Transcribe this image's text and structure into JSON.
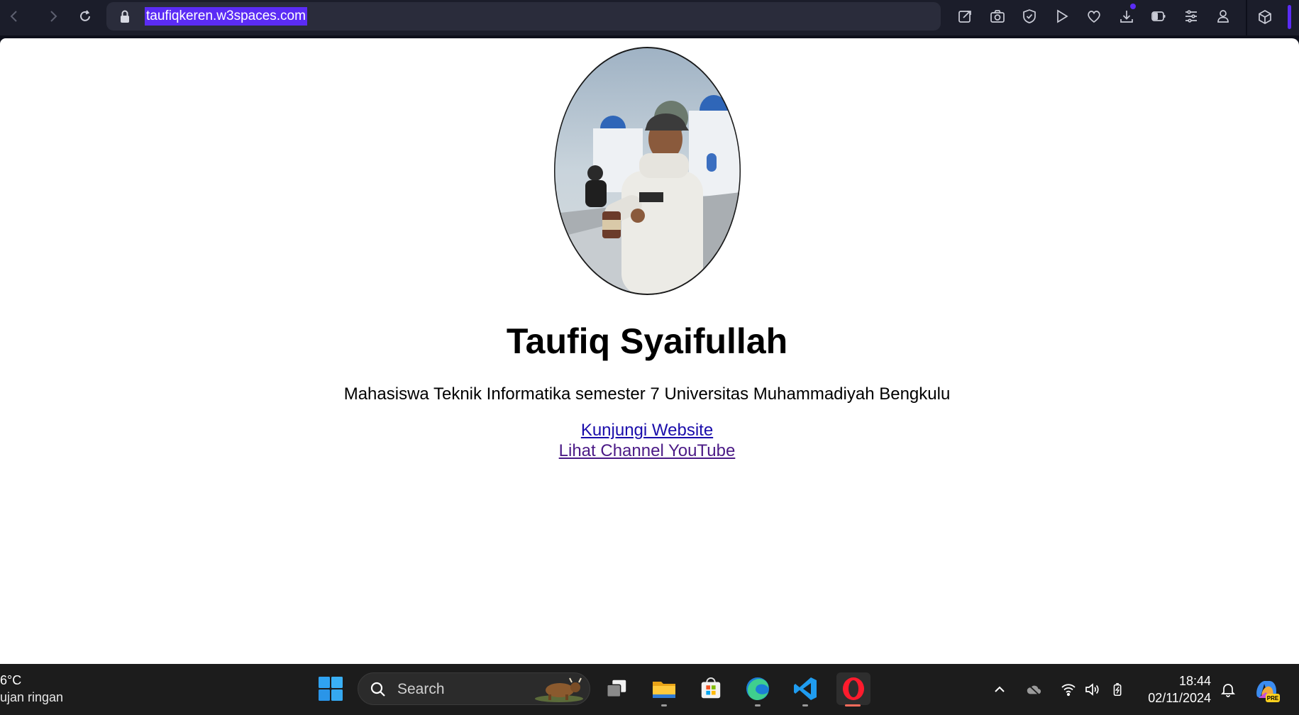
{
  "browser": {
    "url": "taufiqkeren.w3spaces.com",
    "nav_icons": [
      "back-icon",
      "forward-icon",
      "reload-icon"
    ],
    "toolbar_icons": [
      "easy-setup-icon",
      "snapshot-icon",
      "vpn-shield-icon",
      "flow-icon",
      "pinboard-heart-icon",
      "download-icon",
      "battery-saver-icon",
      "settings-sliders-icon",
      "profile-icon"
    ],
    "extensions_icon": "cube-icon",
    "accent": "#5b2cf5"
  },
  "page": {
    "name": "Taufiq Syaifullah",
    "bio": "Mahasiswa Teknik Informatika semester 7 Universitas Muhammadiyah Bengkulu",
    "links": {
      "website": "Kunjungi Website",
      "youtube": "Lihat Channel YouTube"
    },
    "link_colors": {
      "unvisited": "#1a0dab",
      "visited": "#4b1a86"
    }
  },
  "taskbar": {
    "weather_temp": "6°C",
    "weather_condition": "ujan ringan",
    "search_placeholder": "Search",
    "apps": [
      "start-icon",
      "task-view-icon",
      "file-explorer-icon",
      "microsoft-store-icon",
      "edge-icon",
      "vscode-icon",
      "opera-icon"
    ],
    "active_app": "opera-icon",
    "tray": [
      "chevron-up-icon",
      "onedrive-icon",
      "wifi-icon",
      "volume-icon",
      "battery-icon",
      "bell-icon"
    ],
    "time": "18:44",
    "date": "02/11/2024",
    "copilot_badge": "PRE"
  }
}
